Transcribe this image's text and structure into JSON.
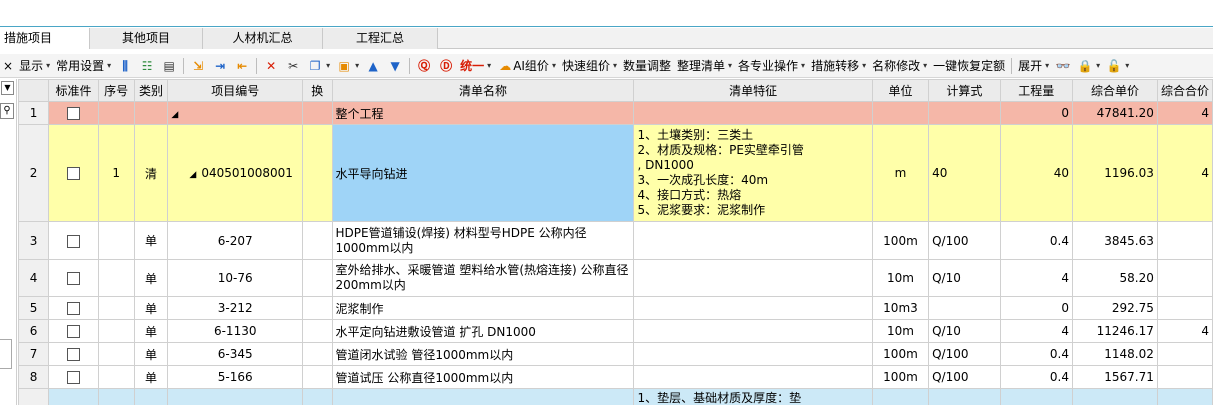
{
  "tabs": [
    "措施项目",
    "其他项目",
    "人材机汇总",
    "工程汇总"
  ],
  "toolbar": {
    "close_glyph": "×",
    "show": "显示",
    "common_settings": "常用设置",
    "unify": "统一",
    "ai_price": "AI组价",
    "quick_price": "快速组价",
    "qty_adjust": "数量调整",
    "organize_list": "整理清单",
    "specialty_ops": "各专业操作",
    "measure_transfer": "措施转移",
    "rename": "名称修改",
    "restore_quota": "一键恢复定额",
    "expand": "展开"
  },
  "columns": {
    "std": "标准件",
    "seq": "序号",
    "cat": "类别",
    "code": "项目编号",
    "swap": "换",
    "name": "清单名称",
    "feature": "清单特征",
    "unit": "单位",
    "formula": "计算式",
    "qty": "工程量",
    "price": "综合单价",
    "total": "综合合价"
  },
  "rows": [
    {
      "rn": "1",
      "seq": "",
      "cat": "",
      "code": "",
      "name": "整个工程",
      "feature": "",
      "unit": "",
      "formula": "",
      "qty": "0",
      "price": "47841.20",
      "total": "4"
    },
    {
      "rn": "2",
      "seq": "1",
      "cat": "清",
      "code": "040501008001",
      "name": "水平导向钻进",
      "feature": "1、土壤类别：三类土\n2、材质及规格：PE实壁牵引管\n, DN1000\n3、一次成孔长度：40m\n4、接口方式：热熔\n5、泥浆要求：泥浆制作",
      "unit": "m",
      "formula": "40",
      "qty": "40",
      "price": "1196.03",
      "total": "4"
    },
    {
      "rn": "3",
      "seq": "",
      "cat": "单",
      "code": "6-207",
      "name": "HDPE管道铺设(焊接) 材料型号HDPE 公称内径1000mm以内",
      "feature": "",
      "unit": "100m",
      "formula": "Q/100",
      "qty": "0.4",
      "price": "3845.63",
      "total": ""
    },
    {
      "rn": "4",
      "seq": "",
      "cat": "单",
      "code": "10-76",
      "name": "室外给排水、采暖管道 塑料给水管(热熔连接) 公称直径200mm以内",
      "feature": "",
      "unit": "10m",
      "formula": "Q/10",
      "qty": "4",
      "price": "58.20",
      "total": ""
    },
    {
      "rn": "5",
      "seq": "",
      "cat": "单",
      "code": "3-212",
      "name": "泥浆制作",
      "feature": "",
      "unit": "10m3",
      "formula": "",
      "qty": "0",
      "price": "292.75",
      "total": ""
    },
    {
      "rn": "6",
      "seq": "",
      "cat": "单",
      "code": "6-1130",
      "name": "水平定向钻进敷设管道 扩孔 DN1000",
      "feature": "",
      "unit": "10m",
      "formula": "Q/10",
      "qty": "4",
      "price": "11246.17",
      "total": "4"
    },
    {
      "rn": "7",
      "seq": "",
      "cat": "单",
      "code": "6-345",
      "name": "管道闭水试验 管径1000mm以内",
      "feature": "",
      "unit": "100m",
      "formula": "Q/100",
      "qty": "0.4",
      "price": "1148.02",
      "total": ""
    },
    {
      "rn": "8",
      "seq": "",
      "cat": "单",
      "code": "5-166",
      "name": "管道试压 公称直径1000mm以内",
      "feature": "",
      "unit": "100m",
      "formula": "Q/100",
      "qty": "0.4",
      "price": "1567.71",
      "total": ""
    },
    {
      "rn": "",
      "seq": "",
      "cat": "",
      "code": "",
      "name": "",
      "feature": "1、垫层、基础材质及厚度：垫",
      "unit": "",
      "formula": "",
      "qty": "",
      "price": "",
      "total": ""
    }
  ]
}
